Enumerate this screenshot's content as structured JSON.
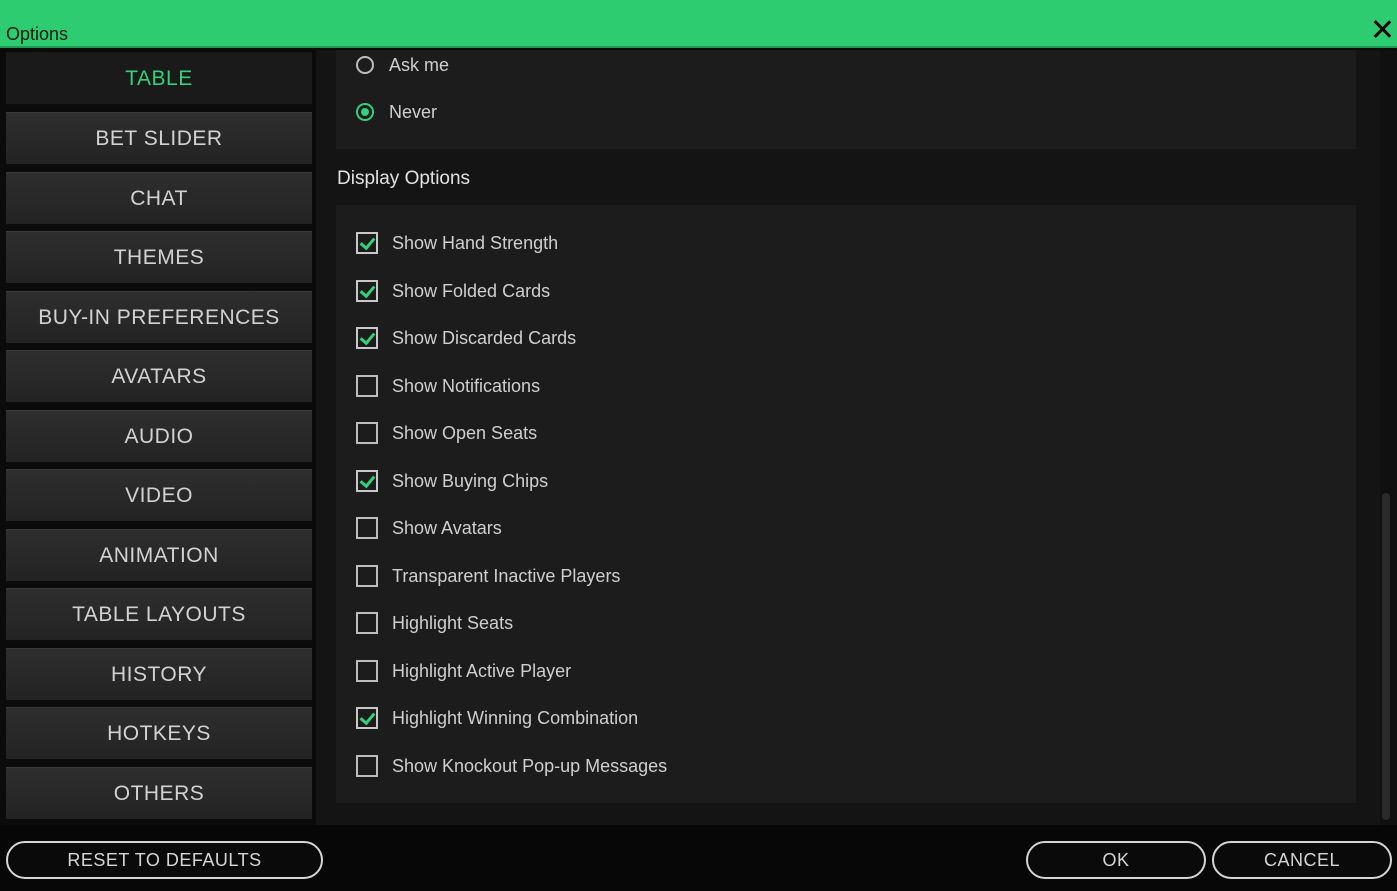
{
  "window": {
    "title": "Options"
  },
  "sidebar": {
    "items": [
      {
        "label": "TABLE",
        "active": true
      },
      {
        "label": "BET SLIDER",
        "active": false
      },
      {
        "label": "CHAT",
        "active": false
      },
      {
        "label": "THEMES",
        "active": false
      },
      {
        "label": "BUY-IN PREFERENCES",
        "active": false
      },
      {
        "label": "AVATARS",
        "active": false
      },
      {
        "label": "AUDIO",
        "active": false
      },
      {
        "label": "VIDEO",
        "active": false
      },
      {
        "label": "ANIMATION",
        "active": false
      },
      {
        "label": "TABLE LAYOUTS",
        "active": false
      },
      {
        "label": "HISTORY",
        "active": false
      },
      {
        "label": "HOTKEYS",
        "active": false
      },
      {
        "label": "OTHERS",
        "active": false
      }
    ]
  },
  "radio_options": [
    {
      "label": "Ask me",
      "selected": false
    },
    {
      "label": "Never",
      "selected": true
    }
  ],
  "display_options": {
    "title": "Display Options",
    "items": [
      {
        "label": "Show Hand Strength",
        "checked": true
      },
      {
        "label": "Show Folded Cards",
        "checked": true
      },
      {
        "label": "Show Discarded Cards",
        "checked": true
      },
      {
        "label": "Show Notifications",
        "checked": false
      },
      {
        "label": "Show Open Seats",
        "checked": false
      },
      {
        "label": "Show Buying Chips",
        "checked": true
      },
      {
        "label": "Show Avatars",
        "checked": false
      },
      {
        "label": "Transparent Inactive Players",
        "checked": false
      },
      {
        "label": "Highlight Seats",
        "checked": false
      },
      {
        "label": "Highlight Active Player",
        "checked": false
      },
      {
        "label": "Highlight Winning Combination",
        "checked": true
      },
      {
        "label": "Show Knockout Pop-up Messages",
        "checked": false
      }
    ]
  },
  "footer": {
    "reset_label": "RESET TO DEFAULTS",
    "ok_label": "OK",
    "cancel_label": "CANCEL"
  },
  "colors": {
    "accent": "#35d07c",
    "titlebar": "#2ecc71"
  }
}
